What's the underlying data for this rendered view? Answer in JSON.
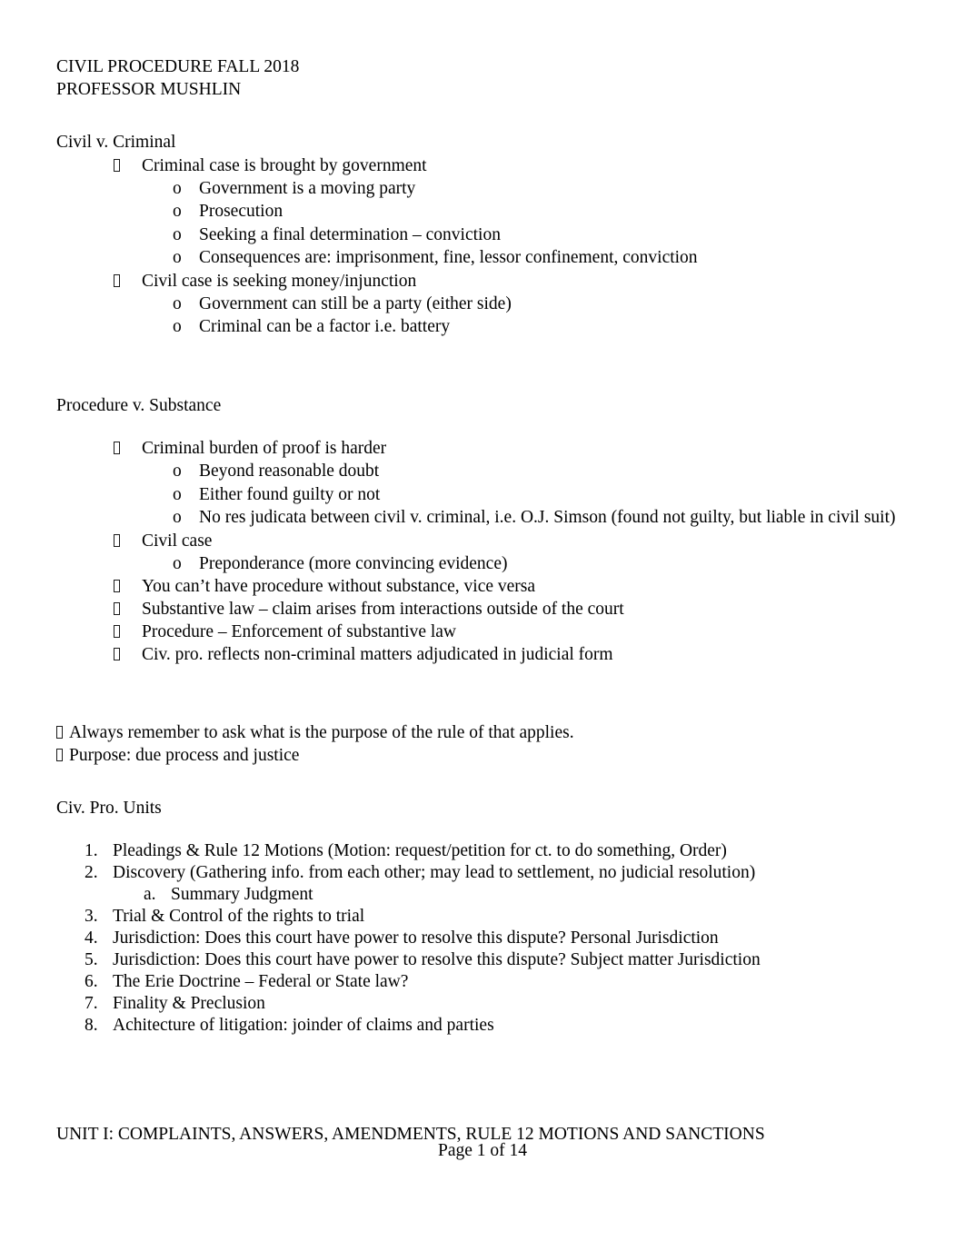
{
  "document": {
    "title_lines": [
      "CIVIL PROCEDURE FALL 2018",
      "PROFESSOR MUSHLIN"
    ],
    "section_1": {
      "heading": "Civil v. Criminal",
      "items": [
        {
          "level": 1,
          "marker": "box-bullet",
          "text": "Criminal case is brought by government"
        },
        {
          "level": 2,
          "marker": "o",
          "text": "Government is a moving party"
        },
        {
          "level": 2,
          "marker": "o",
          "text": "Prosecution"
        },
        {
          "level": 2,
          "marker": "o",
          "text": "Seeking a final determination – conviction"
        },
        {
          "level": 2,
          "marker": "o",
          "text": "Consequences are: imprisonment, fine, lessor confinement, conviction"
        },
        {
          "level": 1,
          "marker": "box-bullet",
          "text": "Civil case is seeking money/injunction"
        },
        {
          "level": 2,
          "marker": "o",
          "text": "Government can still be a party (either side)"
        },
        {
          "level": 2,
          "marker": "o",
          "text": "Criminal can be a factor i.e. battery"
        }
      ]
    },
    "section_2": {
      "heading": "Procedure v. Substance",
      "items": [
        {
          "level": 1,
          "marker": "box-bullet",
          "text": "Criminal burden of proof is harder"
        },
        {
          "level": 2,
          "marker": "o",
          "text": "Beyond reasonable doubt"
        },
        {
          "level": 2,
          "marker": "o",
          "text": "Either found guilty or not"
        },
        {
          "level": 2,
          "marker": "o",
          "text": "No res judicata between civil v. criminal, i.e. O.J. Simson (found not guilty, but liable in civil suit)"
        },
        {
          "level": 1,
          "marker": "box-bullet",
          "text": "Civil case"
        },
        {
          "level": 2,
          "marker": "o",
          "text": "Preponderance (more convincing evidence)"
        },
        {
          "level": 1,
          "marker": "box-bullet",
          "text": "You can’t have procedure without substance, vice versa"
        },
        {
          "level": 1,
          "marker": "box-bullet",
          "text": "Substantive law – claim arises from interactions outside of the court"
        },
        {
          "level": 1,
          "marker": "box-bullet",
          "text": "Procedure – Enforcement of substantive law"
        },
        {
          "level": 1,
          "marker": "box-bullet",
          "text": "Civ. pro. reflects non-criminal matters adjudicated in judicial form"
        }
      ]
    },
    "notes": [
      {
        "level": 0,
        "marker": "box-bullet",
        "text": "Always remember to ask what is the purpose of the rule of that applies."
      },
      {
        "level": 0,
        "marker": "box-bullet",
        "text": "Purpose: due process and justice"
      }
    ],
    "section_3": {
      "heading": "Civ. Pro. Units",
      "items": [
        {
          "level": 1,
          "marker": "1.",
          "text": "Pleadings & Rule 12 Motions (Motion: request/petition for ct. to do something, Order)"
        },
        {
          "level": 1,
          "marker": "2.",
          "text": "Discovery (Gathering info. from each other; may lead to settlement, no judicial resolution)"
        },
        {
          "level": 2,
          "marker": "a.",
          "text": "Summary Judgment"
        },
        {
          "level": 1,
          "marker": "3.",
          "text": "Trial & Control of the rights to trial"
        },
        {
          "level": 1,
          "marker": "4.",
          "text": "Jurisdiction: Does this court have power to resolve this dispute? Personal Jurisdiction"
        },
        {
          "level": 1,
          "marker": "5.",
          "text": "Jurisdiction: Does this court have power to resolve this dispute? Subject matter Jurisdiction"
        },
        {
          "level": 1,
          "marker": "6.",
          "text": "The Erie Doctrine – Federal or State law?"
        },
        {
          "level": 1,
          "marker": "7.",
          "text": "Finality & Preclusion"
        },
        {
          "level": 1,
          "marker": "8.",
          "text": "Achitecture of litigation: joinder of claims and parties"
        }
      ]
    },
    "unit_heading": "UNIT I: COMPLAINTS, ANSWERS, AMENDMENTS, RULE 12 MOTIONS AND SANCTIONS",
    "footer": "Page 1 of 14"
  }
}
